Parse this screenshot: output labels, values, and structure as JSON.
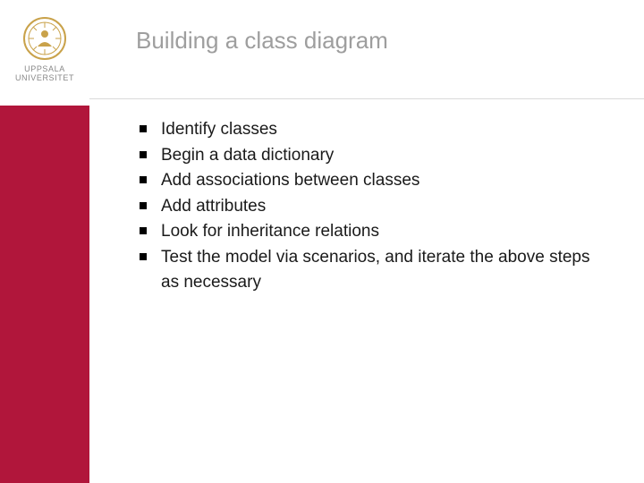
{
  "sidebar": {
    "seal_color": "#c9a24a",
    "uni_line1": "UPPSALA",
    "uni_line2": "UNIVERSITET",
    "bar_color": "#b1163b"
  },
  "title": "Building a class diagram",
  "bullets": [
    "Identify classes",
    "Begin a data dictionary",
    "Add associations between classes",
    "Add attributes",
    "Look for inheritance relations",
    "Test the model via scenarios, and iterate the above steps as necessary"
  ]
}
